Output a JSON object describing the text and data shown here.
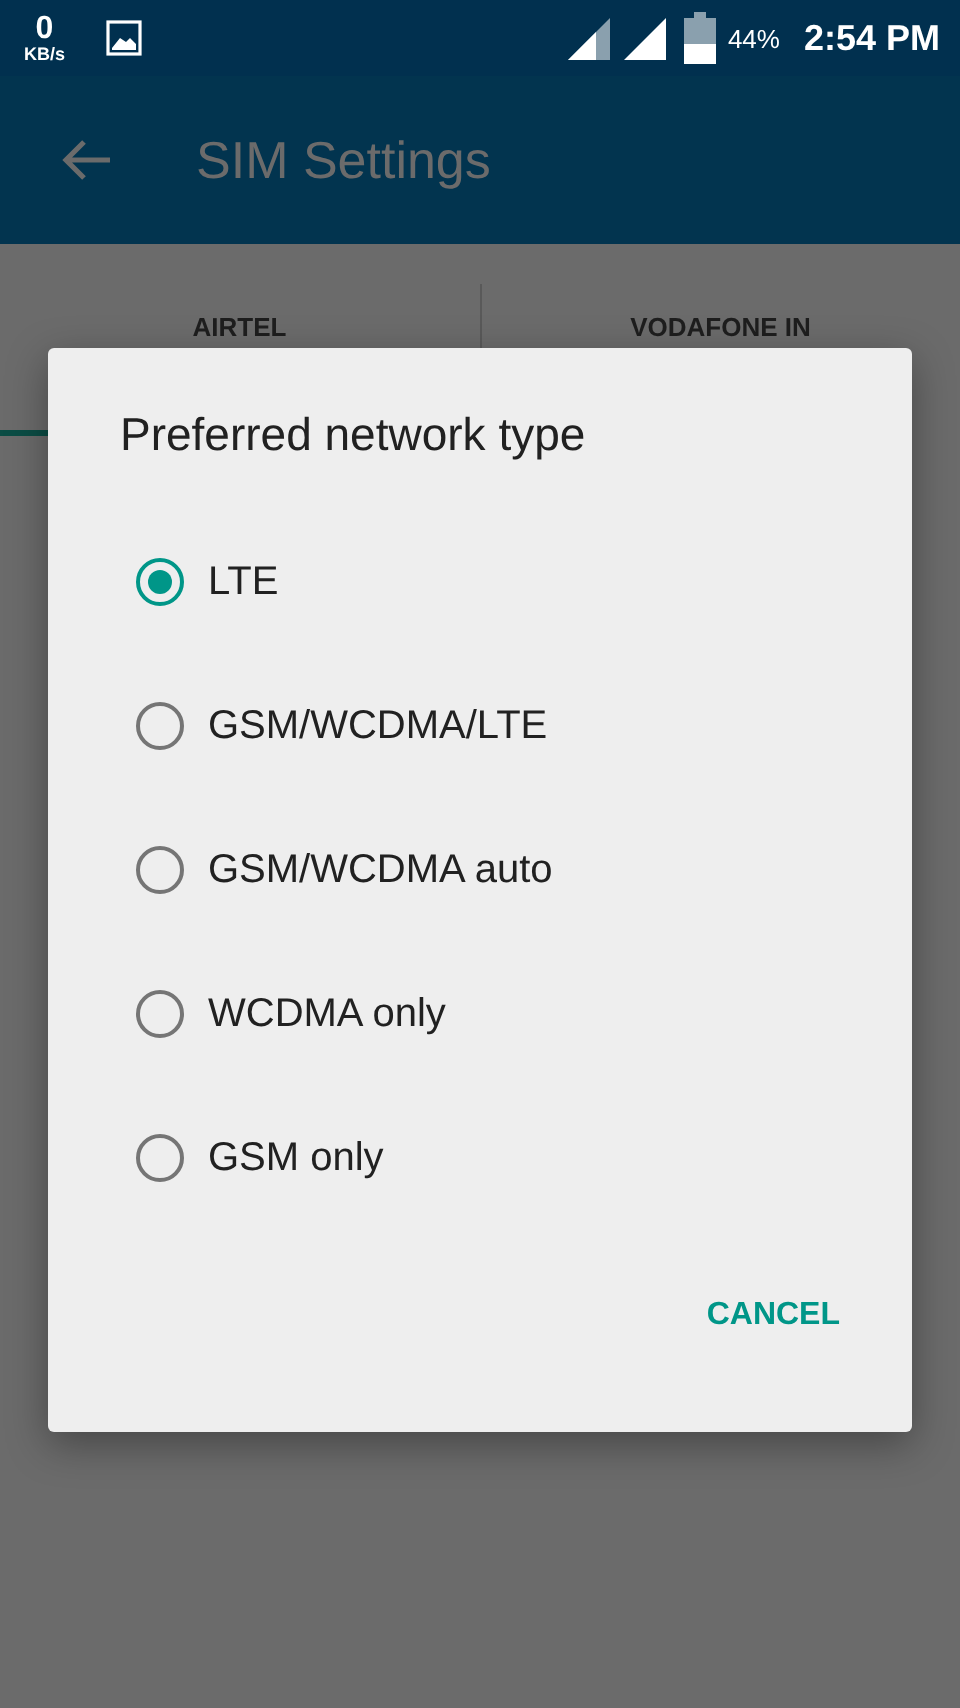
{
  "status_bar": {
    "speed_value": "0",
    "speed_unit": "KB/s",
    "battery_percent": "44%",
    "time": "2:54 PM"
  },
  "toolbar": {
    "title": "SIM Settings"
  },
  "tabs": [
    {
      "label": "AIRTEL",
      "selected": true
    },
    {
      "label": "VODAFONE IN",
      "selected": false
    }
  ],
  "dialog": {
    "title": "Preferred network type",
    "options": [
      {
        "label": "LTE",
        "selected": true
      },
      {
        "label": "GSM/WCDMA/LTE",
        "selected": false
      },
      {
        "label": "GSM/WCDMA auto",
        "selected": false
      },
      {
        "label": "WCDMA only",
        "selected": false
      },
      {
        "label": "GSM only",
        "selected": false
      }
    ],
    "buttons": [
      "CANCEL"
    ]
  }
}
